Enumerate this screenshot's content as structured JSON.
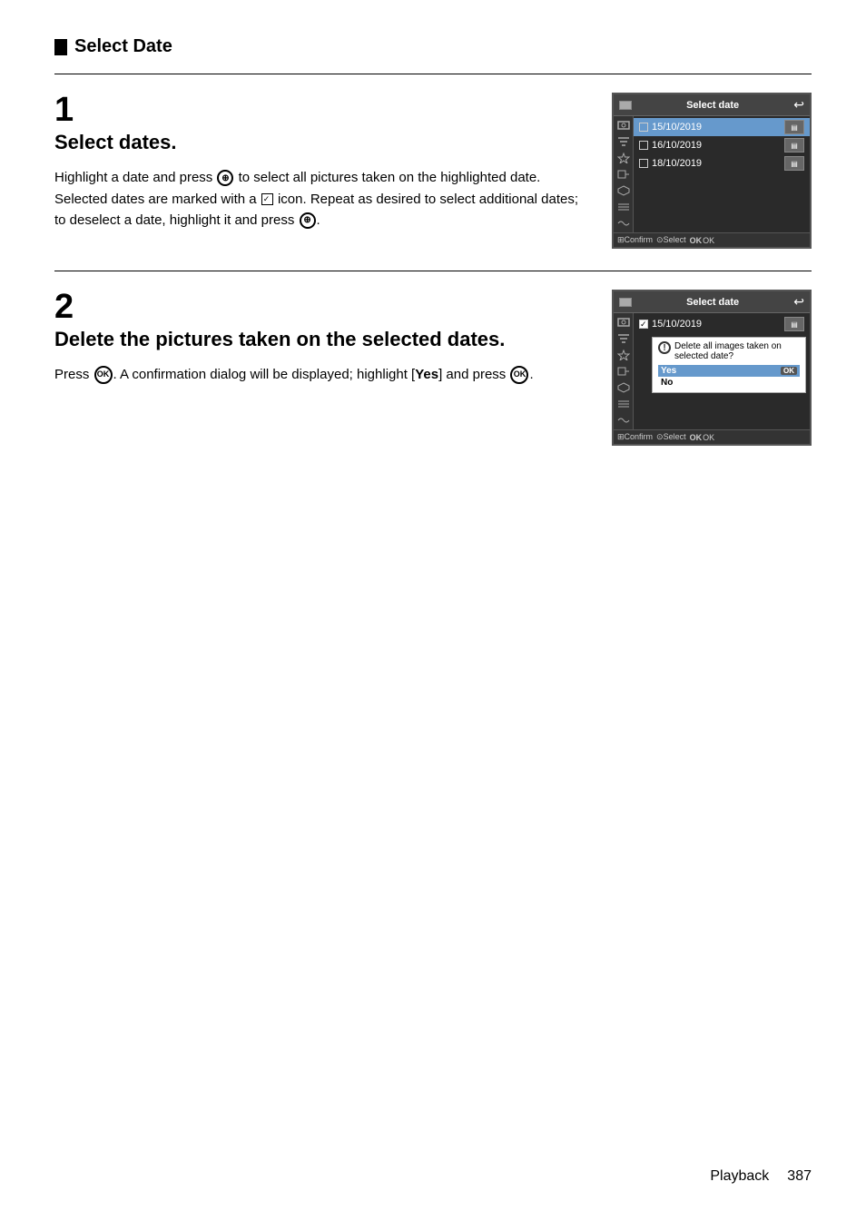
{
  "section": {
    "title": "Select Date"
  },
  "steps": [
    {
      "number": "1",
      "title": "Select dates.",
      "body_parts": [
        "Highlight a date and press ",
        " to select all pictures taken on the highlighted date. Selected dates are marked with a ",
        " icon. Repeat as desired to select additional dates; to deselect a date, highlight it and press ",
        "."
      ],
      "screen": {
        "title": "Select date",
        "dates": [
          {
            "date": "15/10/2019",
            "checked": false,
            "highlighted": true
          },
          {
            "date": "16/10/2019",
            "checked": false,
            "highlighted": false
          },
          {
            "date": "18/10/2019",
            "checked": false,
            "highlighted": false
          }
        ],
        "footer": "Confirm  Select  OK"
      }
    },
    {
      "number": "2",
      "title": "Delete the pictures taken on the selected dates.",
      "body_parts": [
        "Press ",
        ". A confirmation dialog will be displayed; highlight [",
        "Yes",
        "] and press ",
        "."
      ],
      "screen": {
        "title": "Select date",
        "dates": [
          {
            "date": "15/10/2019",
            "checked": true,
            "highlighted": false
          }
        ],
        "dialog": {
          "message": "Delete all images taken on selected date?",
          "options": [
            {
              "label": "Yes",
              "selected": false
            },
            {
              "label": "No",
              "selected": true
            }
          ]
        },
        "footer": "Confirm  Select  OK"
      }
    }
  ],
  "footer": {
    "playback_label": "Playback",
    "page_number": "387"
  }
}
